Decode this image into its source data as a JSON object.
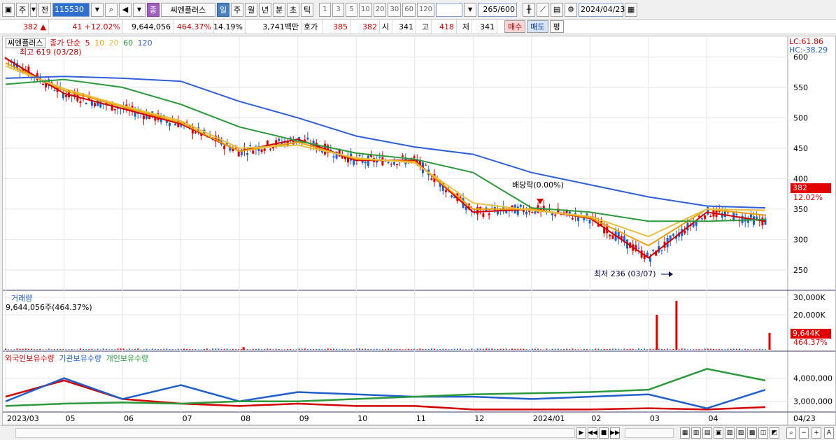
{
  "toolbar": {
    "type_select": "주",
    "all_label": "전",
    "code": "115530",
    "company_badge": "종",
    "company_name": "씨엔플러스",
    "periods": [
      "일",
      "주",
      "월",
      "년",
      "분",
      "초",
      "틱"
    ],
    "active_period": "일",
    "intervals": [
      "1",
      "3",
      "5",
      "10",
      "20",
      "30",
      "60",
      "120"
    ],
    "count_current": "265",
    "count_total": "/600",
    "date": "2024/04/23"
  },
  "quote": {
    "price": "382",
    "change_arrow": "▲",
    "change": "41",
    "change_pct": "+12.02%",
    "volume": "9,644,056",
    "volume_ratio": "464.37%",
    "turnover": "14.19%",
    "amount": "3,741백만",
    "ask_label": "호가",
    "ask1": "385",
    "bid1": "382",
    "open_label": "시",
    "open": "341",
    "high_label": "고",
    "high": "418",
    "low_label": "저",
    "low": "341",
    "buy_label": "매수",
    "sell_label": "매도",
    "avg_label": "평"
  },
  "price_panel": {
    "name": "씨엔플러스",
    "ma_label": "종가 단순",
    "ma_periods": [
      "5",
      "10",
      "20",
      "60",
      "120"
    ],
    "high_note": "최고 619 (03/28)",
    "low_note": "최저 236 (03/07)",
    "dividend_note": "배당락(0.00%)",
    "lc": "LC:61.86",
    "hc": "HC:-38.29",
    "last_price": "382",
    "last_pct": "12.02%",
    "y_ticks": [
      "600",
      "550",
      "500",
      "450",
      "400",
      "350",
      "300",
      "250"
    ]
  },
  "volume_panel": {
    "title": "거래량",
    "value": "9,644,056주(464.37%)",
    "y_ticks": [
      "30,000K",
      "20,000K"
    ],
    "last": "9,644K",
    "last_pct": "464.37%"
  },
  "holding_panel": {
    "series": [
      "외국인보유수량",
      "기관보유수량",
      "개인보유수량"
    ],
    "y_ticks": [
      "4,000,000",
      "3,000,000"
    ]
  },
  "x_axis": {
    "labels": [
      "2023/03",
      "05",
      "06",
      "07",
      "08",
      "09",
      "10",
      "11",
      "12",
      "2024/01",
      "02",
      "03",
      "04"
    ],
    "right_label": "04/23"
  },
  "colors": {
    "up": "#e00000",
    "down": "#1f5fcc",
    "ma5": "#d40000",
    "ma10": "#f0a000",
    "ma20": "#e8c040",
    "ma60": "#2a9a3a",
    "ma120": "#2f5fd8"
  },
  "chart_data": {
    "type": "line",
    "x": [
      "2023/03",
      "05",
      "06",
      "07",
      "08",
      "09",
      "10",
      "11",
      "12",
      "2024/01",
      "02",
      "03",
      "04",
      "04/23"
    ],
    "series": [
      {
        "name": "5",
        "values": [
          598,
          540,
          515,
          490,
          445,
          465,
          430,
          430,
          345,
          350,
          335,
          270,
          345,
          330
        ]
      },
      {
        "name": "10",
        "values": [
          590,
          545,
          518,
          492,
          445,
          460,
          432,
          428,
          350,
          350,
          336,
          290,
          350,
          340
        ]
      },
      {
        "name": "20",
        "values": [
          585,
          548,
          520,
          495,
          450,
          455,
          434,
          426,
          360,
          348,
          338,
          305,
          350,
          348
        ]
      },
      {
        "name": "60",
        "values": [
          555,
          563,
          550,
          522,
          485,
          462,
          442,
          432,
          410,
          352,
          345,
          330,
          330,
          333
        ]
      },
      {
        "name": "120",
        "values": [
          565,
          568,
          565,
          560,
          527,
          500,
          470,
          452,
          440,
          410,
          390,
          370,
          355,
          352
        ]
      }
    ],
    "ylim": [
      220,
      620
    ],
    "volume_peaks_K": [
      {
        "x": "08",
        "value": 1500
      },
      {
        "x": "03",
        "value": 28000
      },
      {
        "x": "03",
        "value": 20000
      },
      {
        "x": "04/23",
        "value": 9644
      }
    ],
    "volume_ylim": [
      0,
      32000
    ],
    "holding_ylim": [
      2600000,
      4800000
    ]
  }
}
